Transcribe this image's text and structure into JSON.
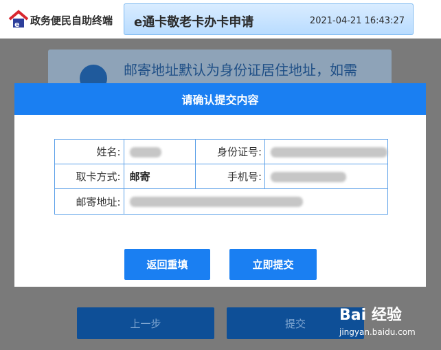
{
  "header": {
    "logo_text": "政务便民自助终端",
    "title": "e通卡敬老卡办卡申请",
    "datetime": "2021-04-21 16:43:27"
  },
  "background": {
    "notice_text": "邮寄地址默认为身份证居住地址，如需",
    "prev_button": "上一步",
    "submit_button": "提交"
  },
  "dialog": {
    "title": "请确认提交内容",
    "fields": {
      "name_label": "姓名:",
      "id_label": "身份证号:",
      "pickup_label": "取卡方式:",
      "pickup_value": "邮寄",
      "phone_label": "手机号:",
      "address_label": "邮寄地址:"
    },
    "back_button": "返回重填",
    "confirm_button": "立即提交"
  },
  "watermark": {
    "brand": "Bai 经验",
    "url": "jingyan.baidu.com"
  },
  "colors": {
    "accent": "#1a7ff2",
    "table_border": "#5a9fe8"
  }
}
